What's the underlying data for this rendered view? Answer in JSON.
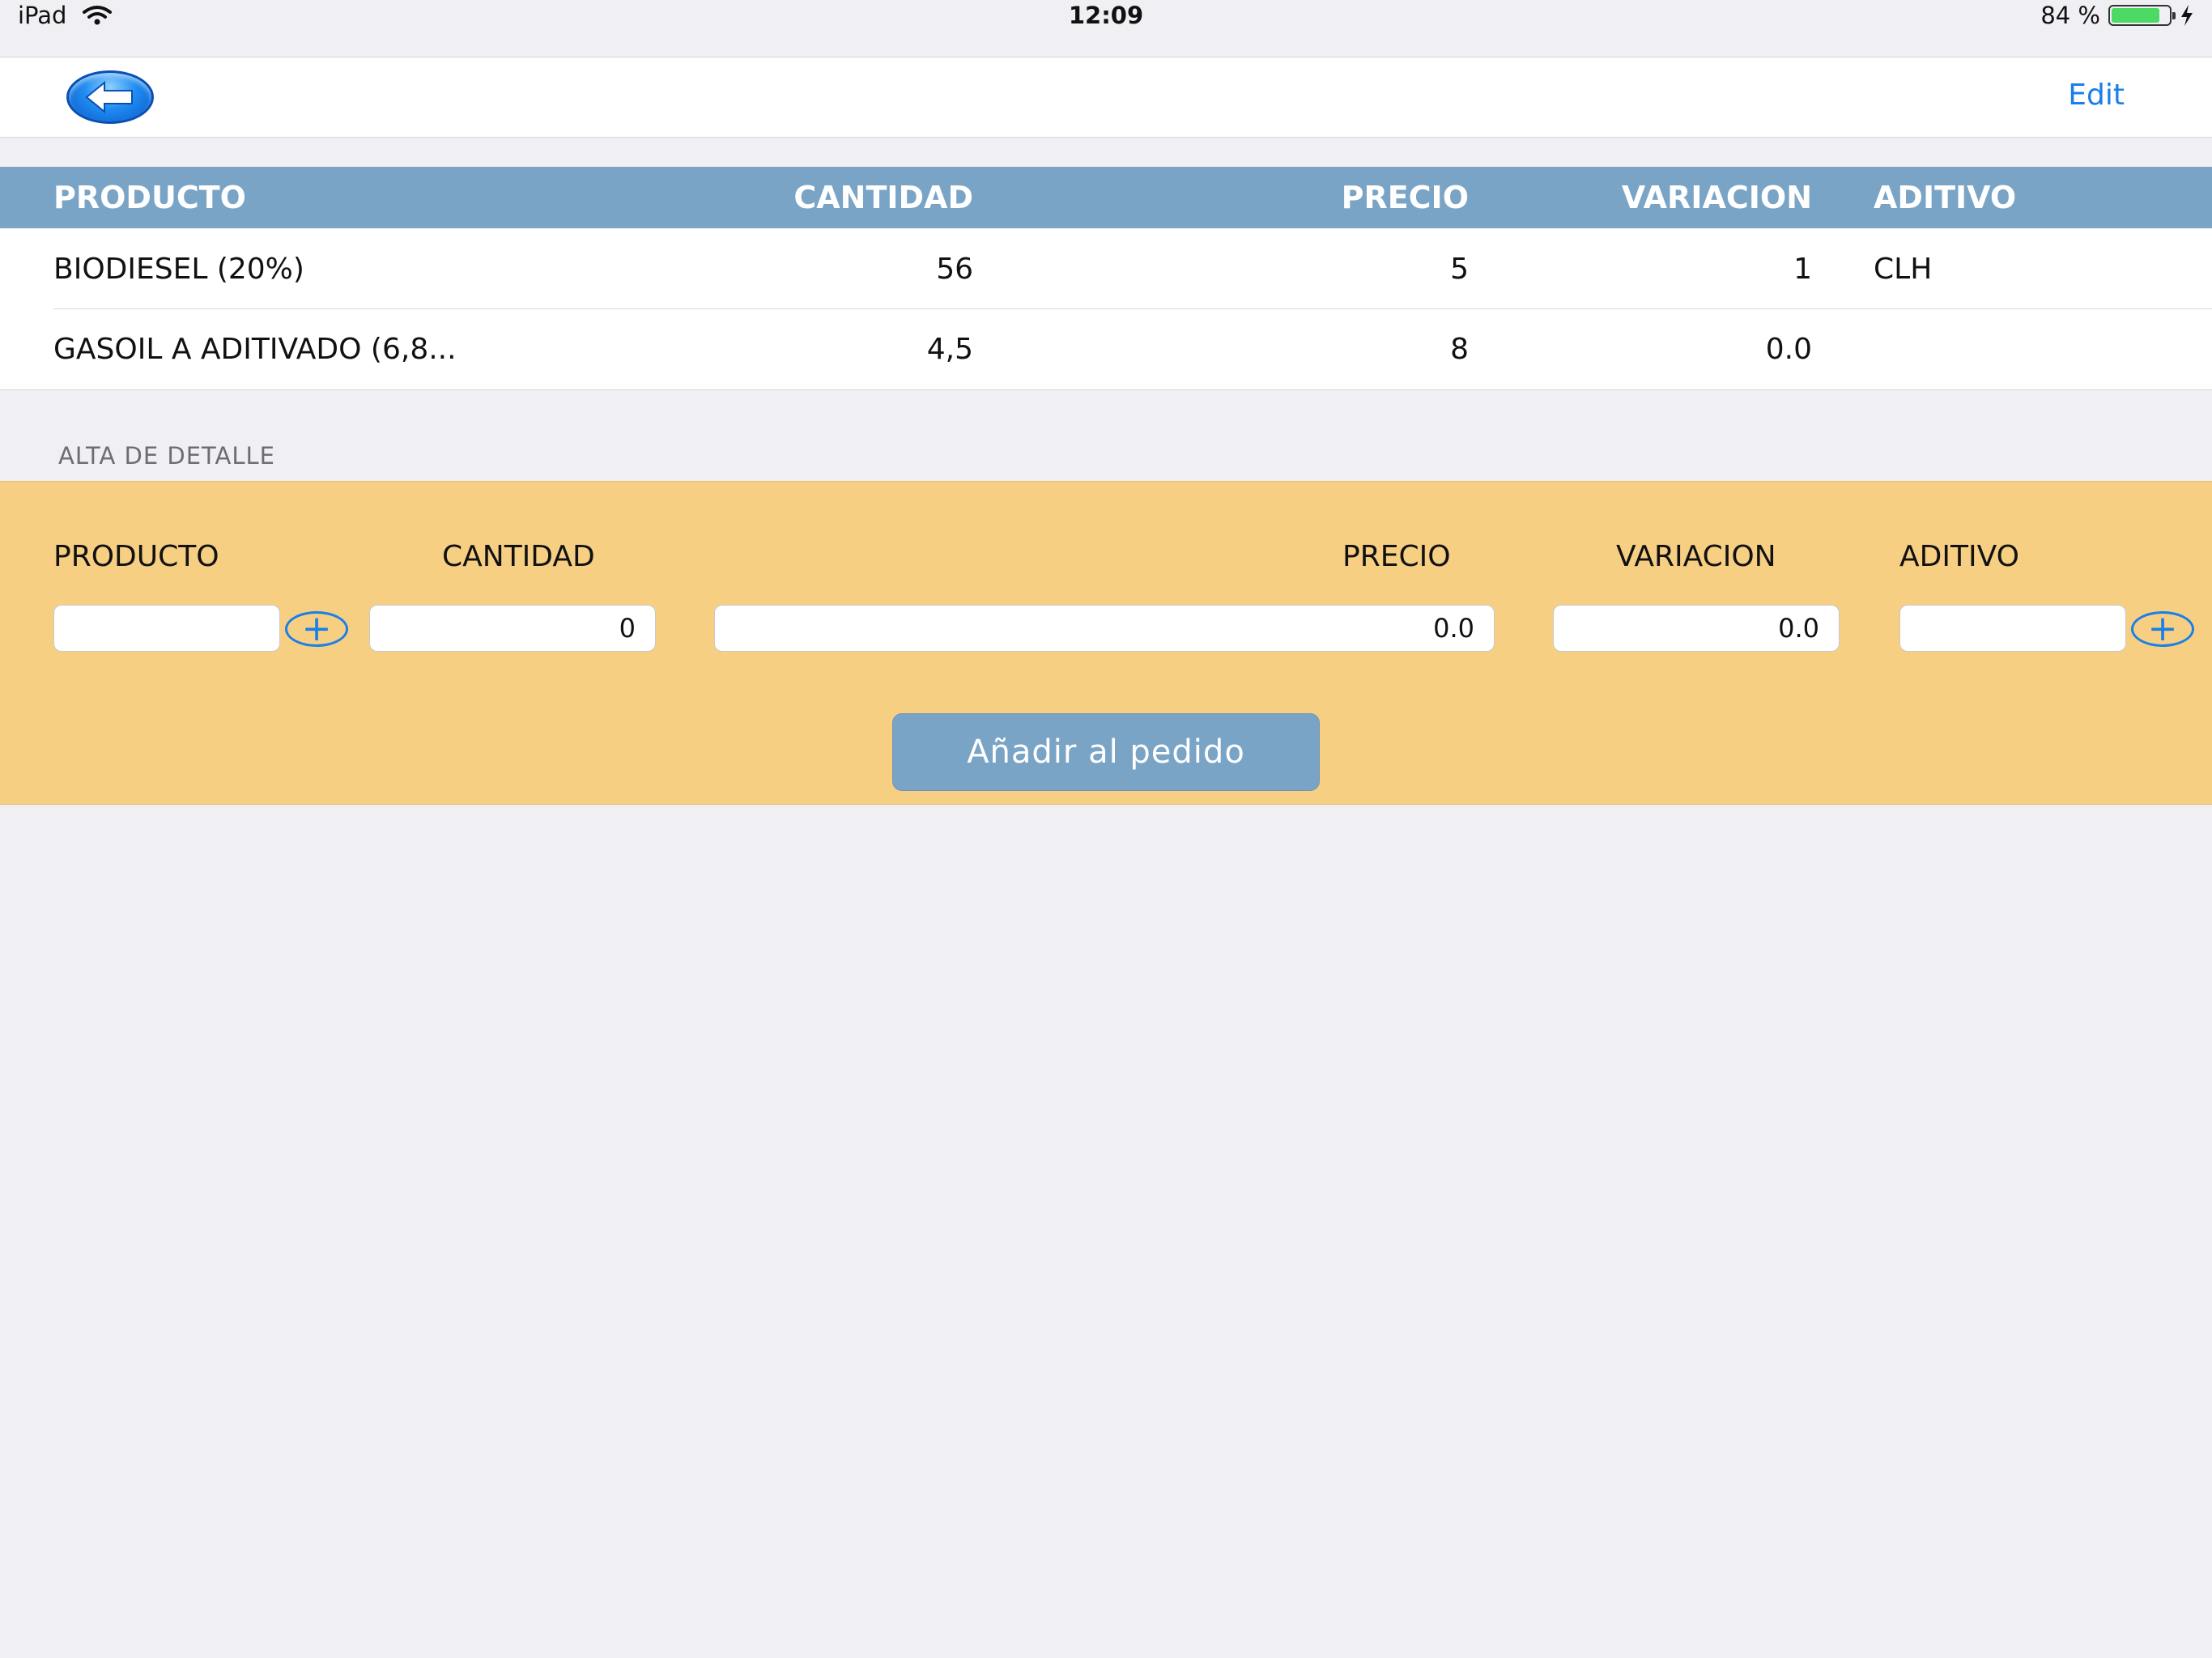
{
  "status_bar": {
    "device": "iPad",
    "time": "12:09",
    "battery": "84 %",
    "battery_level": 0.84
  },
  "nav": {
    "back_icon": "back-arrow-icon",
    "edit_label": "Edit"
  },
  "table": {
    "headers": [
      "PRODUCTO",
      "CANTIDAD",
      "PRECIO",
      "VARIACION",
      "ADITIVO"
    ],
    "rows": [
      [
        "BIODIESEL (20%)",
        "56",
        "5",
        "1",
        "CLH"
      ],
      [
        "GASOIL A  ADITIVADO (6,8...",
        "4,5",
        "8",
        "0.0",
        ""
      ]
    ]
  },
  "detail": {
    "section_label": "ALTA DE DETALLE",
    "labels": {
      "producto": "PRODUCTO",
      "cantidad": "CANTIDAD",
      "precio": "PRECIO",
      "variacion": "VARIACION",
      "aditivo": "ADITIVO"
    },
    "values": {
      "producto": "",
      "cantidad": "0",
      "precio": "0.0",
      "variacion": "0.0",
      "aditivo": ""
    },
    "plus_glyph": "+",
    "add_button_label": "Añadir al pedido"
  },
  "colors": {
    "header_bg": "#7aa4c6",
    "panel_bg": "#f7cf82",
    "accent": "#1a7fe8"
  }
}
